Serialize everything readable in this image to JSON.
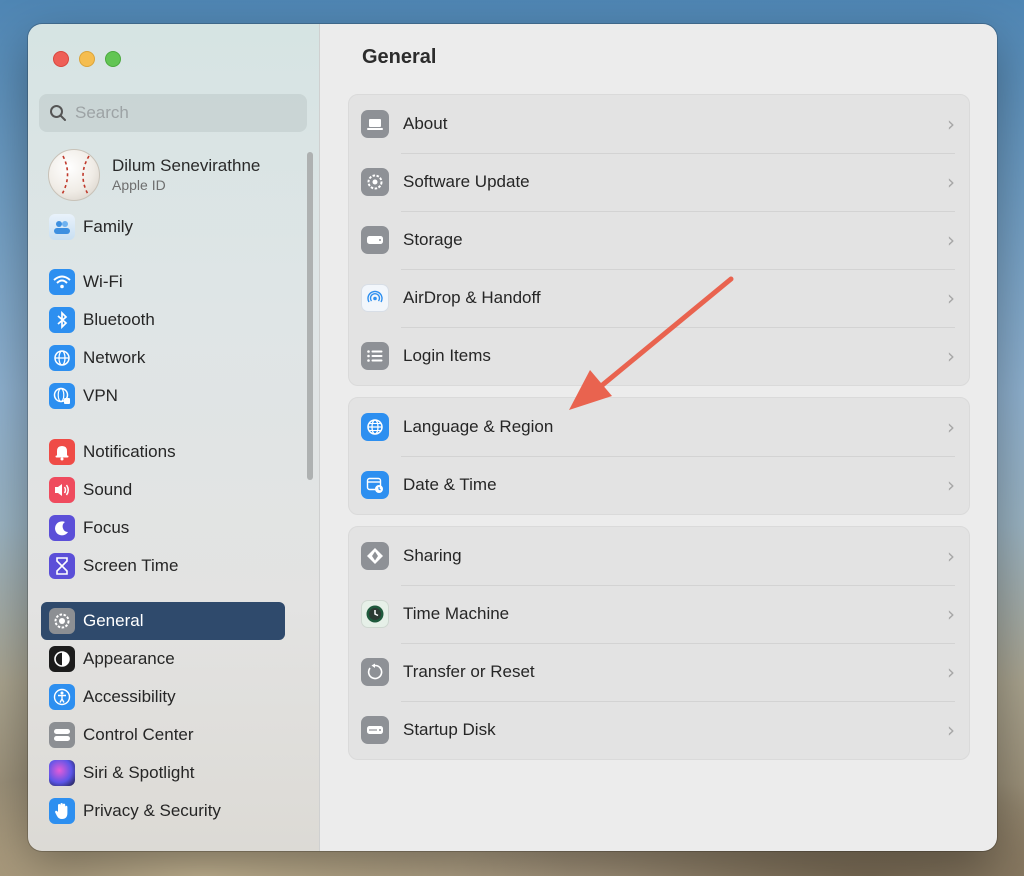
{
  "sidebar": {
    "search_placeholder": "Search",
    "profile": {
      "name": "Dilum Senevirathne",
      "subtitle": "Apple ID"
    },
    "family": "Family",
    "group_network": [
      "Wi-Fi",
      "Bluetooth",
      "Network",
      "VPN"
    ],
    "group_alerts": [
      "Notifications",
      "Sound",
      "Focus",
      "Screen Time"
    ],
    "group_system": [
      "General",
      "Appearance",
      "Accessibility",
      "Control Center",
      "Siri & Spotlight",
      "Privacy & Security"
    ],
    "active_item": "General"
  },
  "main": {
    "title": "General",
    "groups": [
      [
        "About",
        "Software Update",
        "Storage",
        "AirDrop & Handoff",
        "Login Items"
      ],
      [
        "Language & Region",
        "Date & Time"
      ],
      [
        "Sharing",
        "Time Machine",
        "Transfer or Reset",
        "Startup Disk"
      ]
    ]
  },
  "colors": {
    "sidebar_active": "#2f4a6c",
    "annotation_arrow": "#e9634f",
    "close": "#ee5f57",
    "minimize": "#f5bd4f",
    "maximize": "#62c554"
  }
}
